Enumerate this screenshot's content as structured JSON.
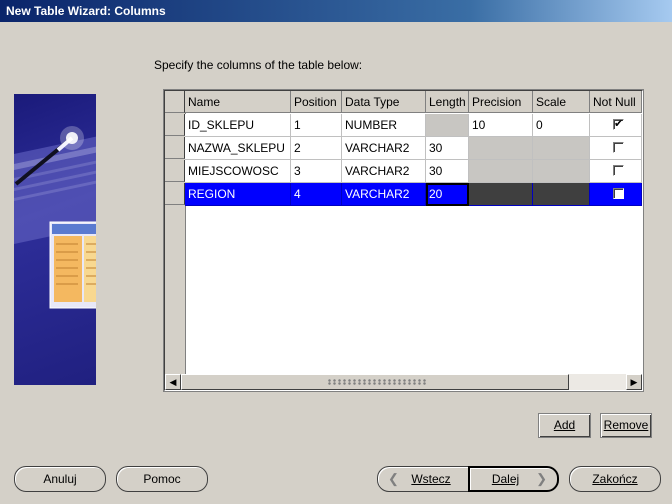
{
  "window": {
    "title": "New Table Wizard: Columns"
  },
  "instruction": "Specify the columns of the table below:",
  "table": {
    "columns": [
      "Name",
      "Position",
      "Data Type",
      "Length",
      "Precision",
      "Scale",
      "Not Null"
    ],
    "rows": [
      {
        "name": "ID_SKLEPU",
        "position": "1",
        "data_type": "NUMBER",
        "length": "",
        "precision": "10",
        "scale": "0",
        "not_null": true
      },
      {
        "name": "NAZWA_SKLEPU",
        "position": "2",
        "data_type": "VARCHAR2",
        "length": "30",
        "precision": "",
        "scale": "",
        "not_null": false
      },
      {
        "name": "MIEJSCOWOSC",
        "position": "3",
        "data_type": "VARCHAR2",
        "length": "30",
        "precision": "",
        "scale": "",
        "not_null": false
      },
      {
        "name": "REGION",
        "position": "4",
        "data_type": "VARCHAR2",
        "length": "20",
        "precision": "",
        "scale": "",
        "not_null": false
      }
    ],
    "selected_row": 3
  },
  "buttons": {
    "add": "Add",
    "remove": "Remove",
    "cancel": "Anuluj",
    "help": "Pomoc",
    "back": "Wstecz",
    "next": "Dalej",
    "finish": "Zakończ"
  },
  "icons": {
    "back": "left-chevron-icon",
    "next": "right-chevron-icon",
    "scroll_left": "scroll-left-icon",
    "scroll_right": "scroll-right-icon",
    "checkmark": "checkmark-icon"
  },
  "colors": {
    "selection": "#0000ff",
    "titlebar": "#0a246a",
    "dialog": "#d4d0c8"
  }
}
